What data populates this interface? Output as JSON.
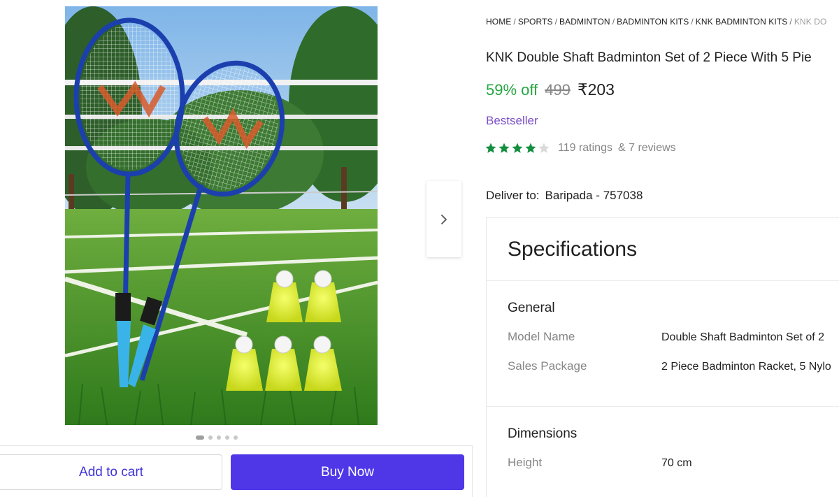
{
  "breadcrumb": [
    {
      "label": "HOME"
    },
    {
      "label": "SPORTS"
    },
    {
      "label": "BADMINTON"
    },
    {
      "label": "BADMINTON KITS"
    },
    {
      "label": "KNK BADMINTON KITS"
    },
    {
      "label": "KNK DO"
    }
  ],
  "product": {
    "title": "KNK Double Shaft Badminton Set of 2 Piece With 5 Pie",
    "discount": "59% off",
    "mrp": "499",
    "price": "₹203",
    "badge": "Bestseller",
    "rating_stars": 4,
    "rating_max": 5,
    "ratings_count": "119 ratings",
    "reviews_count": "& 7 reviews"
  },
  "delivery": {
    "label": "Deliver to:",
    "location": "Baripada - 757038"
  },
  "gallery": {
    "image_count": 5,
    "active_index": 0,
    "next_icon": "chevron-right-icon"
  },
  "actions": {
    "add_to_cart": "Add to cart",
    "buy_now": "Buy Now"
  },
  "specifications": {
    "heading": "Specifications",
    "sections": [
      {
        "title": "General",
        "rows": [
          {
            "key": "Model Name",
            "value": "Double Shaft Badminton Set of 2"
          },
          {
            "key": "Sales Package",
            "value": "2 Piece Badminton Racket, 5 Nylo"
          }
        ]
      },
      {
        "title": "Dimensions",
        "rows": [
          {
            "key": "Height",
            "value": "70 cm"
          }
        ]
      }
    ]
  },
  "colors": {
    "discount_green": "#26a541",
    "bestseller_purple": "#7b4fc5",
    "star_green": "#138f3f",
    "buy_button": "#4f37e8",
    "cart_text": "#3f33d6"
  }
}
